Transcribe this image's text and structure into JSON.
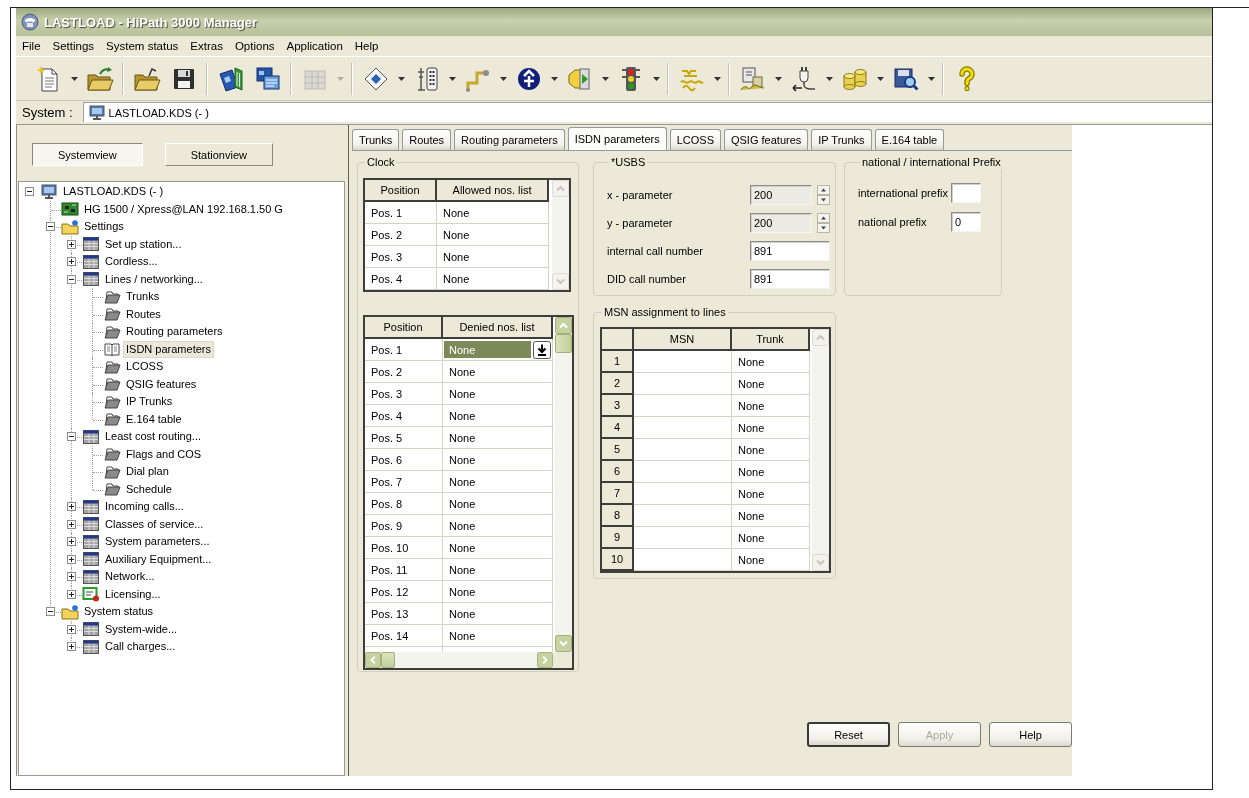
{
  "window": {
    "title": "LASTLOAD - HiPath 3000 Manager"
  },
  "menu": [
    "File",
    "Settings",
    "System status",
    "Extras",
    "Options",
    "Application",
    "Help"
  ],
  "toolbar": [
    [
      {
        "dropdown": true,
        "disabled": false
      },
      {
        "dropdown": false,
        "disabled": false
      }
    ],
    [
      {
        "dropdown": false,
        "disabled": false
      },
      {
        "dropdown": false,
        "disabled": false
      }
    ],
    [
      {
        "dropdown": false,
        "disabled": false
      },
      {
        "dropdown": false,
        "disabled": false
      }
    ],
    [
      {
        "dropdown": true,
        "disabled": true
      }
    ],
    [
      {
        "dropdown": true,
        "disabled": false
      },
      {
        "dropdown": true,
        "disabled": false
      },
      {
        "dropdown": true,
        "disabled": false
      },
      {
        "dropdown": true,
        "disabled": false
      },
      {
        "dropdown": true,
        "disabled": false
      },
      {
        "dropdown": true,
        "disabled": false
      }
    ],
    [
      {
        "dropdown": true,
        "disabled": false
      }
    ],
    [
      {
        "dropdown": true,
        "disabled": false
      },
      {
        "dropdown": true,
        "disabled": false
      },
      {
        "dropdown": true,
        "disabled": false
      },
      {
        "dropdown": true,
        "disabled": false
      }
    ],
    [
      {
        "dropdown": false,
        "disabled": false
      }
    ]
  ],
  "system_bar": {
    "label": "System :",
    "value": "LASTLOAD.KDS (- )"
  },
  "sidebar": {
    "view_buttons": [
      {
        "label": "Systemview",
        "selected": true
      },
      {
        "label": "Stationview",
        "selected": false
      }
    ],
    "tree": [
      {
        "label": "LASTLOAD.KDS (- )",
        "kind": "system",
        "expanded": true,
        "selected": false,
        "children": [
          {
            "label": "HG 1500 / Xpress@LAN 192.168.1.50 G",
            "kind": "board",
            "selected": false
          },
          {
            "label": "Settings",
            "kind": "folder",
            "expanded": true,
            "selected": false,
            "children": [
              {
                "label": "Set up station...",
                "kind": "table",
                "expanded": false,
                "selected": false
              },
              {
                "label": "Cordless...",
                "kind": "table",
                "expanded": false,
                "selected": false
              },
              {
                "label": "Lines / networking...",
                "kind": "table",
                "expanded": true,
                "selected": false,
                "children": [
                  {
                    "label": "Trunks",
                    "kind": "page",
                    "selected": false
                  },
                  {
                    "label": "Routes",
                    "kind": "page",
                    "selected": false
                  },
                  {
                    "label": "Routing parameters",
                    "kind": "page",
                    "selected": false
                  },
                  {
                    "label": "ISDN parameters",
                    "kind": "page",
                    "selected": true
                  },
                  {
                    "label": "LCOSS",
                    "kind": "page",
                    "selected": false
                  },
                  {
                    "label": "QSIG features",
                    "kind": "page",
                    "selected": false
                  },
                  {
                    "label": "IP Trunks",
                    "kind": "page",
                    "selected": false
                  },
                  {
                    "label": "E.164 table",
                    "kind": "page",
                    "selected": false
                  }
                ]
              },
              {
                "label": "Least cost routing...",
                "kind": "table",
                "expanded": true,
                "selected": false,
                "children": [
                  {
                    "label": "Flags and COS",
                    "kind": "page",
                    "selected": false
                  },
                  {
                    "label": "Dial plan",
                    "kind": "page",
                    "selected": false
                  },
                  {
                    "label": "Schedule",
                    "kind": "page",
                    "selected": false
                  }
                ]
              },
              {
                "label": "Incoming calls...",
                "kind": "table",
                "expanded": false,
                "selected": false
              },
              {
                "label": "Classes of service...",
                "kind": "table",
                "expanded": false,
                "selected": false
              },
              {
                "label": "System parameters...",
                "kind": "table",
                "expanded": false,
                "selected": false
              },
              {
                "label": "Auxiliary Equipment...",
                "kind": "table",
                "expanded": false,
                "selected": false
              },
              {
                "label": "Network...",
                "kind": "table",
                "expanded": false,
                "selected": false
              },
              {
                "label": "Licensing...",
                "kind": "license",
                "expanded": false,
                "selected": false
              }
            ]
          },
          {
            "label": "System status",
            "kind": "folder",
            "expanded": true,
            "selected": false,
            "children": [
              {
                "label": "System-wide...",
                "kind": "table",
                "expanded": false,
                "selected": false
              },
              {
                "label": "Call charges...",
                "kind": "table",
                "expanded": false,
                "selected": false
              }
            ]
          }
        ]
      }
    ]
  },
  "tabs": [
    {
      "label": "Trunks",
      "selected": false
    },
    {
      "label": "Routes",
      "selected": false
    },
    {
      "label": "Routing parameters",
      "selected": false
    },
    {
      "label": "ISDN parameters",
      "selected": true
    },
    {
      "label": "LCOSS",
      "selected": false
    },
    {
      "label": "QSIG features",
      "selected": false
    },
    {
      "label": "IP Trunks",
      "selected": false
    },
    {
      "label": "E.164 table",
      "selected": false
    }
  ],
  "clock": {
    "title": "Clock",
    "allowed_table": {
      "columns": [
        "Position",
        "Allowed nos. list"
      ],
      "rows": [
        {
          "position": "Pos. 1",
          "value": "None",
          "selected": false
        },
        {
          "position": "Pos. 2",
          "value": "None",
          "selected": false
        },
        {
          "position": "Pos. 3",
          "value": "None",
          "selected": false
        },
        {
          "position": "Pos. 4",
          "value": "None",
          "selected": false
        }
      ]
    },
    "denied_table": {
      "columns": [
        "Position",
        "Denied nos. list"
      ],
      "rows": [
        {
          "position": "Pos. 1",
          "value": "None",
          "selected": true
        },
        {
          "position": "Pos. 2",
          "value": "None",
          "selected": false
        },
        {
          "position": "Pos. 3",
          "value": "None",
          "selected": false
        },
        {
          "position": "Pos. 4",
          "value": "None",
          "selected": false
        },
        {
          "position": "Pos. 5",
          "value": "None",
          "selected": false
        },
        {
          "position": "Pos. 6",
          "value": "None",
          "selected": false
        },
        {
          "position": "Pos. 7",
          "value": "None",
          "selected": false
        },
        {
          "position": "Pos. 8",
          "value": "None",
          "selected": false
        },
        {
          "position": "Pos. 9",
          "value": "None",
          "selected": false
        },
        {
          "position": "Pos. 10",
          "value": "None",
          "selected": false
        },
        {
          "position": "Pos. 11",
          "value": "None",
          "selected": false
        },
        {
          "position": "Pos. 12",
          "value": "None",
          "selected": false
        },
        {
          "position": "Pos. 13",
          "value": "None",
          "selected": false
        },
        {
          "position": "Pos. 14",
          "value": "None",
          "selected": false
        }
      ]
    }
  },
  "usbs": {
    "title": "*USBS",
    "fields": [
      {
        "label": "x - parameter",
        "value": "200",
        "kind": "spin",
        "disabled": true
      },
      {
        "label": "y - parameter",
        "value": "200",
        "kind": "spin",
        "disabled": true
      },
      {
        "label": "internal call number",
        "value": "891",
        "kind": "text",
        "disabled": false
      },
      {
        "label": "DID call number",
        "value": "891",
        "kind": "text",
        "disabled": false
      }
    ]
  },
  "prefix": {
    "title": "national / international Prefix",
    "fields": [
      {
        "label": "international prefix"
      },
      {
        "label": "national prefix",
        "value": "0"
      }
    ]
  },
  "msn": {
    "title": "MSN assignment to lines",
    "columns": [
      "MSN",
      "Trunk"
    ],
    "rows": [
      {
        "number": "1",
        "trunk": "None",
        "selected": false
      },
      {
        "number": "2",
        "trunk": "None",
        "selected": false
      },
      {
        "number": "3",
        "trunk": "None",
        "selected": false
      },
      {
        "number": "4",
        "trunk": "None",
        "selected": false
      },
      {
        "number": "5",
        "trunk": "None",
        "selected": false
      },
      {
        "number": "6",
        "trunk": "None",
        "selected": false
      },
      {
        "number": "7",
        "trunk": "None",
        "selected": false
      },
      {
        "number": "8",
        "trunk": "None",
        "selected": false
      },
      {
        "number": "9",
        "trunk": "None",
        "selected": false
      },
      {
        "number": "10",
        "trunk": "None",
        "selected": false
      }
    ]
  },
  "buttons": [
    {
      "label": "Reset",
      "default": true,
      "disabled": false
    },
    {
      "label": "Apply",
      "default": false,
      "disabled": true
    },
    {
      "label": "Help",
      "default": false,
      "disabled": false
    }
  ]
}
